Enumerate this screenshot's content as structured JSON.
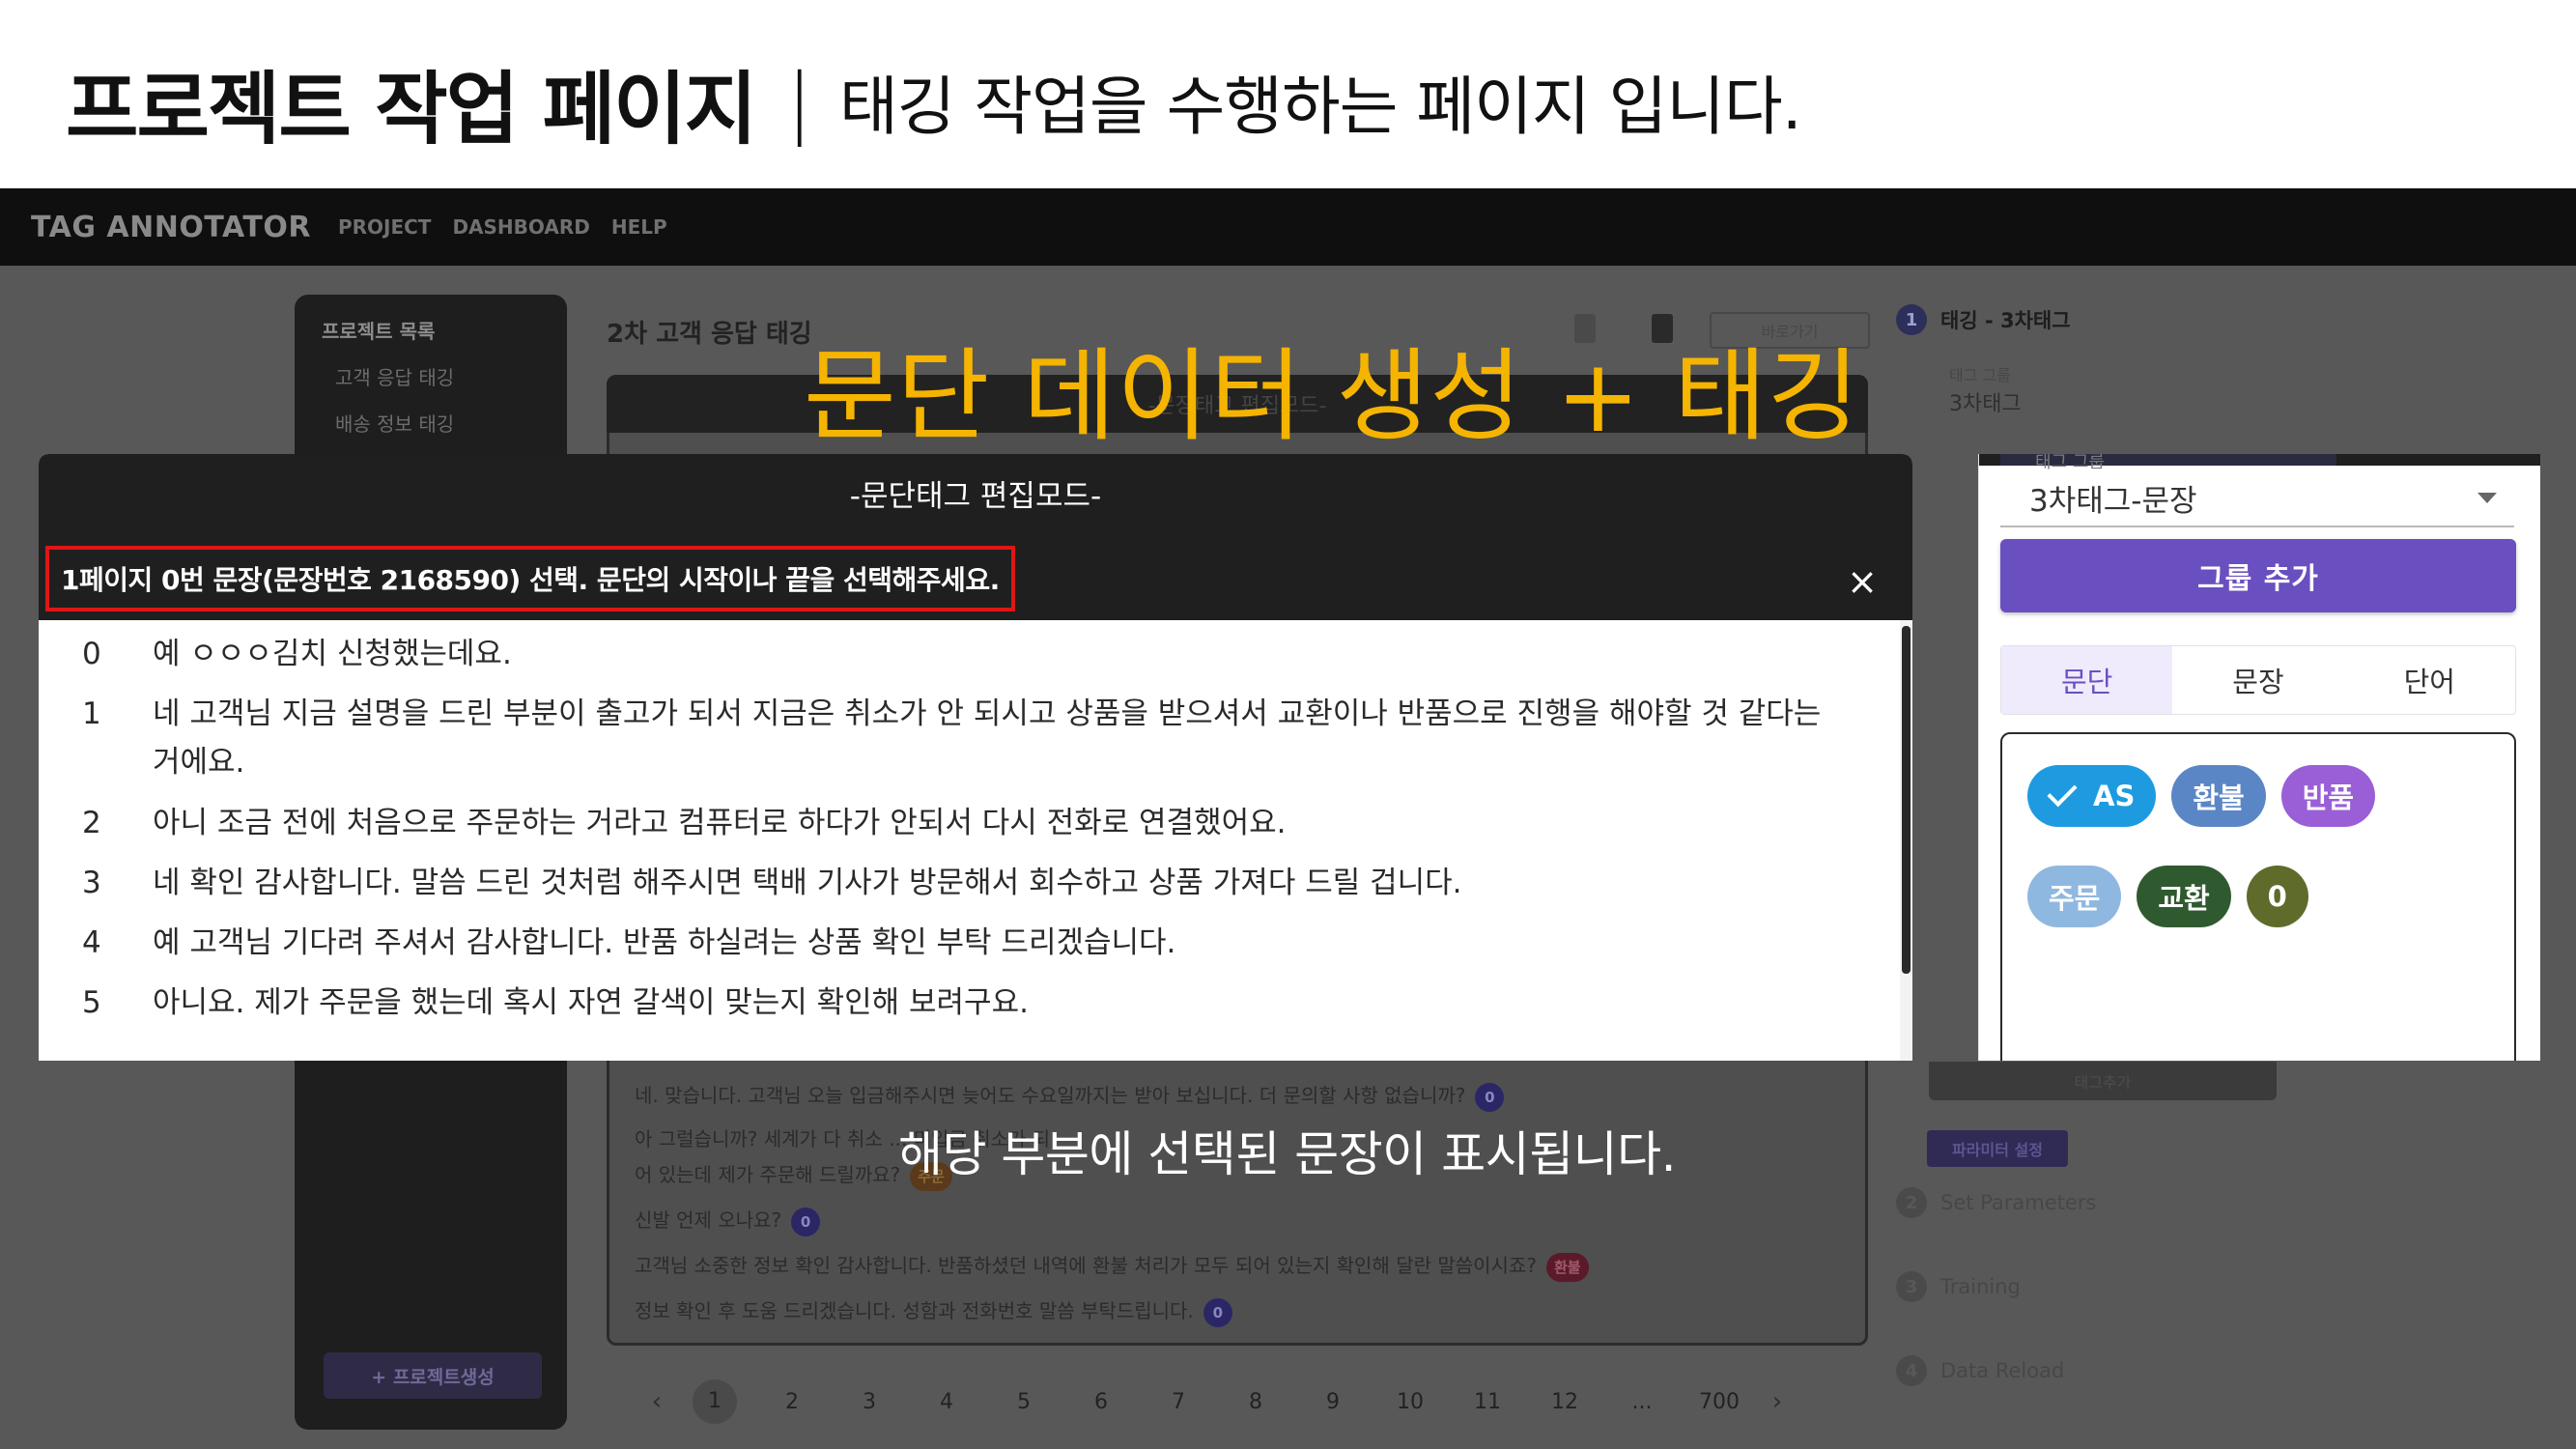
{
  "slide": {
    "title": "프로젝트 작업 페이지",
    "separator": "|",
    "subtitle": "태깅 작업을 수행하는 페이지 입니다."
  },
  "highlight": {
    "headline": "문단 데이터 생성 + 태깅",
    "caption": "해당 부분에 선택된 문장이 표시됩니다.",
    "color": "#f5b400"
  },
  "app": {
    "brand": "TAG ANNOTATOR",
    "nav": [
      "PROJECT",
      "DASHBOARD",
      "HELP"
    ]
  },
  "sidebar": {
    "heading": "프로젝트 목록",
    "items": [
      "고객 응답 태깅",
      "배송 정보 태깅"
    ],
    "create_label": "+ 프로젝트생성"
  },
  "main": {
    "title": "2차 고객 응답 태깅",
    "shortcut_label": "바로가기",
    "card_header": "-문장태그 편집모드-",
    "bg_lines": [
      {
        "text": "네. 맞습니다. 고객님 오늘 입금해주시면 늦어도 수요일까지는 받아 보십니다. 더 문의할 사항 없습니까?",
        "badge": "0",
        "badge_color": "#2b2766"
      },
      {
        "text": "아 그럴습니까? 세계가 다 취소 ... 미입금 취소가 되",
        "badge": "",
        "badge_color": ""
      },
      {
        "text": "어 있는데 제가 주문해 드릴까요?",
        "badge": "주문",
        "badge_color": "#5a3a1a"
      },
      {
        "text": "신발 언제 오나요?",
        "badge": "0",
        "badge_color": "#2b2766"
      },
      {
        "text": "고객님 소중한 정보 확인 감사합니다. 반품하셨던 내역에 환불 처리가 모두 되어 있는지 확인해 달란 말씀이시죠?",
        "badge": "환불",
        "badge_color": "#5a1a2a"
      },
      {
        "text": "정보 확인 후 도움 드리겠습니다. 성함과 전화번호 말씀 부탁드립니다.",
        "badge": "0",
        "badge_color": "#2b2766"
      }
    ],
    "pages": [
      "1",
      "2",
      "3",
      "4",
      "5",
      "6",
      "7",
      "8",
      "9",
      "10",
      "11",
      "12",
      "...",
      "700"
    ],
    "current_page": "1",
    "prev": "‹",
    "next": "›"
  },
  "steps": [
    {
      "num": "1",
      "label": "태깅 - 3차태그",
      "active": true
    },
    {
      "num": "2",
      "label": "Set Parameters",
      "active": false
    },
    {
      "num": "3",
      "label": "Training",
      "active": false
    },
    {
      "num": "4",
      "label": "Data Reload",
      "active": false
    }
  ],
  "bg_right": {
    "group_label": "태그 그룹",
    "group_value": "3차태그",
    "tag_add": "태그추가",
    "param_button": "파라미터 설정"
  },
  "modal": {
    "title": "-문단태그 편집모드-",
    "notice": "1페이지 0번 문장(문장번호 2168590) 선택. 문단의 시작이나 끝을 선택해주세요.",
    "close": "×",
    "sentences": [
      {
        "idx": "0",
        "text": "예 ㅇㅇㅇ김치 신청했는데요."
      },
      {
        "idx": "1",
        "text": "네 고객님 지금 설명을 드린 부분이 출고가 되서 지금은 취소가 안 되시고 상품을 받으셔서 교환이나 반품으로 진행을 해야할 것 같다는 거에요."
      },
      {
        "idx": "2",
        "text": "아니 조금 전에 처음으로 주문하는 거라고 컴퓨터로 하다가 안되서 다시 전화로 연결했어요."
      },
      {
        "idx": "3",
        "text": "네 확인 감사합니다. 말씀 드린 것처럼 해주시면 택배 기사가 방문해서 회수하고 상품 가져다 드릴 겁니다."
      },
      {
        "idx": "4",
        "text": "예 고객님 기다려 주셔서 감사합니다. 반품 하실려는 상품 확인 부탁 드리겠습니다."
      },
      {
        "idx": "5",
        "text": "아니요. 제가 주문을 했는데 혹시 자연 갈색이 맞는지 확인해 보려구요."
      }
    ]
  },
  "right_panel": {
    "group_label": "태그 그룹",
    "group_value": "3차태그-문장",
    "add_group": "그룹 추가",
    "tabs": [
      "문단",
      "문장",
      "단어"
    ],
    "active_tab": "문단",
    "tags": [
      {
        "label": "AS",
        "color": "#1e9be0",
        "checked": true,
        "shape": "pill"
      },
      {
        "label": "환불",
        "color": "#5b86c6",
        "checked": false,
        "shape": "pill"
      },
      {
        "label": "반품",
        "color": "#9a5fd6",
        "checked": false,
        "shape": "pill"
      },
      {
        "label": "주문",
        "color": "#8fb8e0",
        "checked": false,
        "shape": "pill"
      },
      {
        "label": "교환",
        "color": "#2f5a2f",
        "checked": false,
        "shape": "pill"
      },
      {
        "label": "0",
        "color": "#5e6b2a",
        "checked": false,
        "shape": "round"
      }
    ]
  }
}
